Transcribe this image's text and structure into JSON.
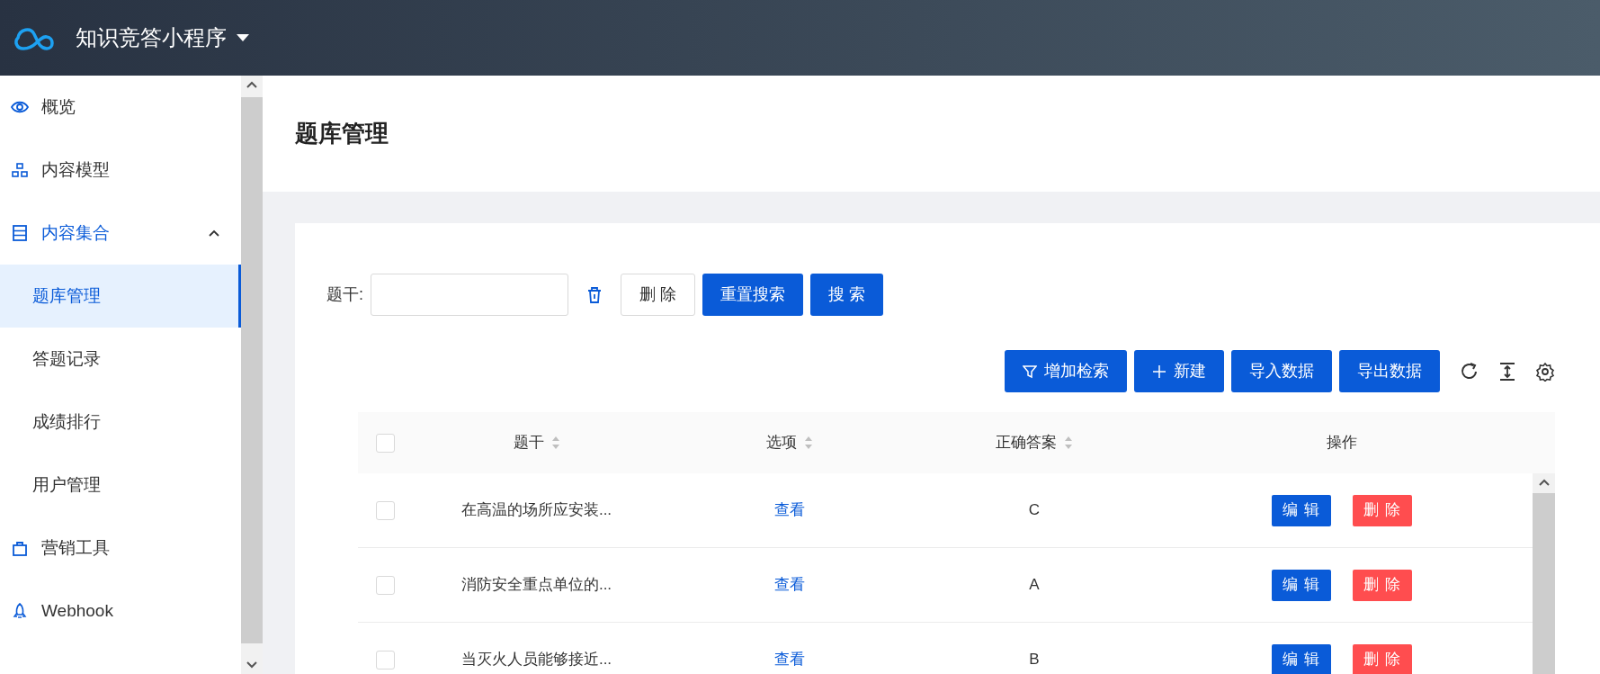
{
  "app": {
    "title": "知识竞答小程序"
  },
  "sidebar": {
    "items": [
      {
        "label": "概览",
        "selected": false
      },
      {
        "label": "内容模型",
        "selected": false
      },
      {
        "label": "内容集合",
        "expanded": true,
        "children": [
          {
            "label": "题库管理",
            "selected": true
          },
          {
            "label": "答题记录",
            "selected": false
          },
          {
            "label": "成绩排行",
            "selected": false
          },
          {
            "label": "用户管理",
            "selected": false
          }
        ]
      },
      {
        "label": "营销工具",
        "selected": false
      },
      {
        "label": "Webhook",
        "selected": false
      }
    ]
  },
  "page": {
    "title": "题库管理"
  },
  "search": {
    "label": "题干:",
    "buttons": [
      {
        "label": "删 除",
        "kind": "outline"
      },
      {
        "label": "重置搜索",
        "kind": "primary"
      },
      {
        "label": "搜 索",
        "kind": "primary"
      }
    ]
  },
  "toolbar": {
    "buttons": [
      {
        "label": "增加检索",
        "kind": "filter"
      },
      {
        "label": "新建",
        "kind": "add"
      },
      {
        "label": "导入数据",
        "kind": "plain"
      },
      {
        "label": "导出数据",
        "kind": "plain"
      }
    ]
  },
  "table": {
    "select_all_checked": false,
    "columns": [
      {
        "label": "题干",
        "sortable": true
      },
      {
        "label": "选项",
        "sortable": true
      },
      {
        "label": "正确答案",
        "sortable": true
      },
      {
        "label": "操作",
        "sortable": false
      }
    ],
    "rows": [
      {
        "checked": false,
        "question": "在高温的场所应安装...",
        "options": "查看",
        "answer": "C",
        "actions": [
          {
            "label": "编 辑",
            "kind": "edit"
          },
          {
            "label": "删 除",
            "kind": "delete"
          }
        ]
      },
      {
        "checked": false,
        "question": "消防安全重点单位的...",
        "options": "查看",
        "answer": "A",
        "actions": [
          {
            "label": "编 辑",
            "kind": "edit"
          },
          {
            "label": "删 除",
            "kind": "delete"
          }
        ]
      },
      {
        "checked": false,
        "question": "当灭火人员能够接近...",
        "options": "查看",
        "answer": "B",
        "actions": [
          {
            "label": "编 辑",
            "kind": "edit"
          },
          {
            "label": "删 除",
            "kind": "delete"
          }
        ]
      }
    ]
  }
}
